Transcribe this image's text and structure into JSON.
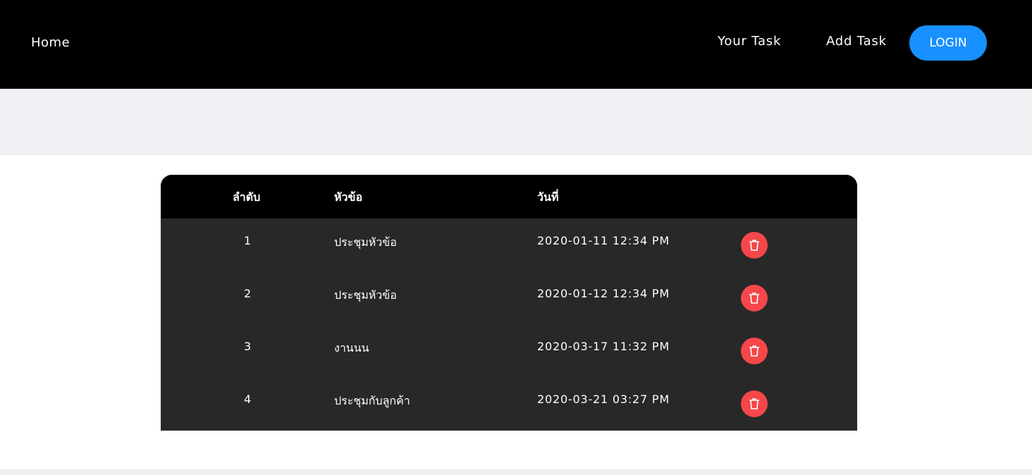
{
  "nav": {
    "home": "Home",
    "your_task": "Your Task",
    "add_task": "Add Task",
    "login": "LOGIN"
  },
  "table": {
    "headers": {
      "num": "ลำดับ",
      "title": "หัวข้อ",
      "date": "วันที่"
    },
    "rows": [
      {
        "num": "1",
        "title": "ประชุมหัวข้อ",
        "date": "2020-01-11 12:34 PM"
      },
      {
        "num": "2",
        "title": "ประชุมหัวข้อ",
        "date": "2020-01-12 12:34 PM"
      },
      {
        "num": "3",
        "title": "งานนน",
        "date": "2020-03-17 11:32 PM"
      },
      {
        "num": "4",
        "title": "ประชุมกับลูกค้า",
        "date": "2020-03-21 03:27 PM"
      }
    ],
    "delete_icon": "trash-icon"
  },
  "colors": {
    "nav_bg": "#000000",
    "login_bg": "#1890ff",
    "table_body_bg": "#282828",
    "delete_bg": "#f5474a",
    "band_bg": "#eff0f3"
  }
}
